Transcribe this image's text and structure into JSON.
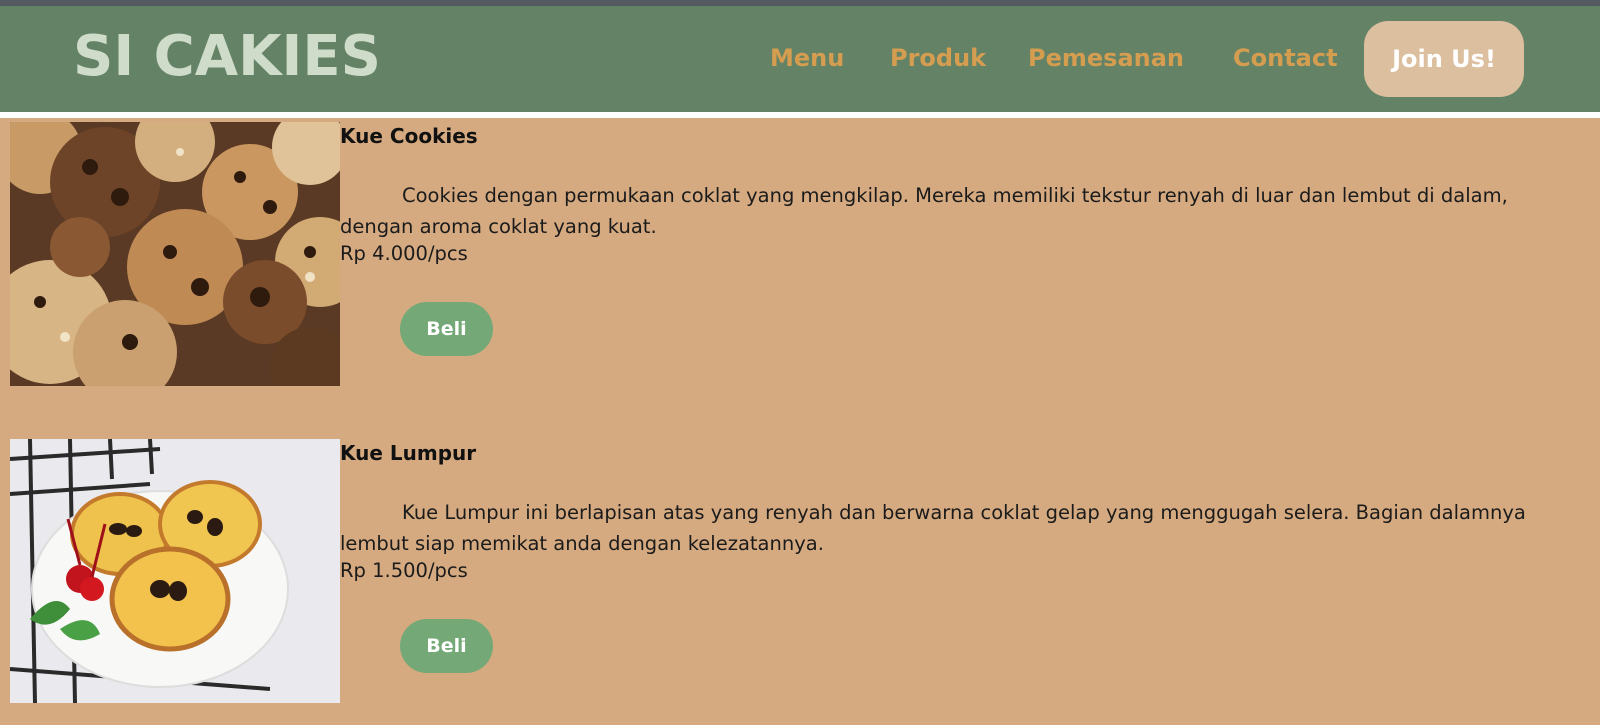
{
  "header": {
    "brand": "SI CAKIES",
    "nav": [
      "Menu",
      "Produk",
      "Pemesanan",
      "Contact"
    ],
    "cta": "Join Us!"
  },
  "products": [
    {
      "name": "Kue Cookies",
      "description": "Cookies dengan permukaan coklat yang mengkilap. Mereka memiliki tekstur renyah di luar dan lembut di dalam, dengan aroma coklat yang kuat.",
      "price": "Rp 4.000/pcs",
      "button": "Beli"
    },
    {
      "name": "Kue Lumpur",
      "description": "Kue Lumpur ini berlapisan atas yang renyah dan berwarna coklat gelap yang menggugah selera. Bagian dalamnya lembut siap memikat anda dengan kelezatannya.",
      "price": "Rp 1.500/pcs",
      "button": "Beli"
    }
  ],
  "colors": {
    "navbar": "#648266",
    "brand": "#cfdcc9",
    "nav_link": "#d59d4f",
    "cta_bg": "#dbbf9e",
    "content_bg": "#d6aa80",
    "buy_button": "#74a977"
  }
}
